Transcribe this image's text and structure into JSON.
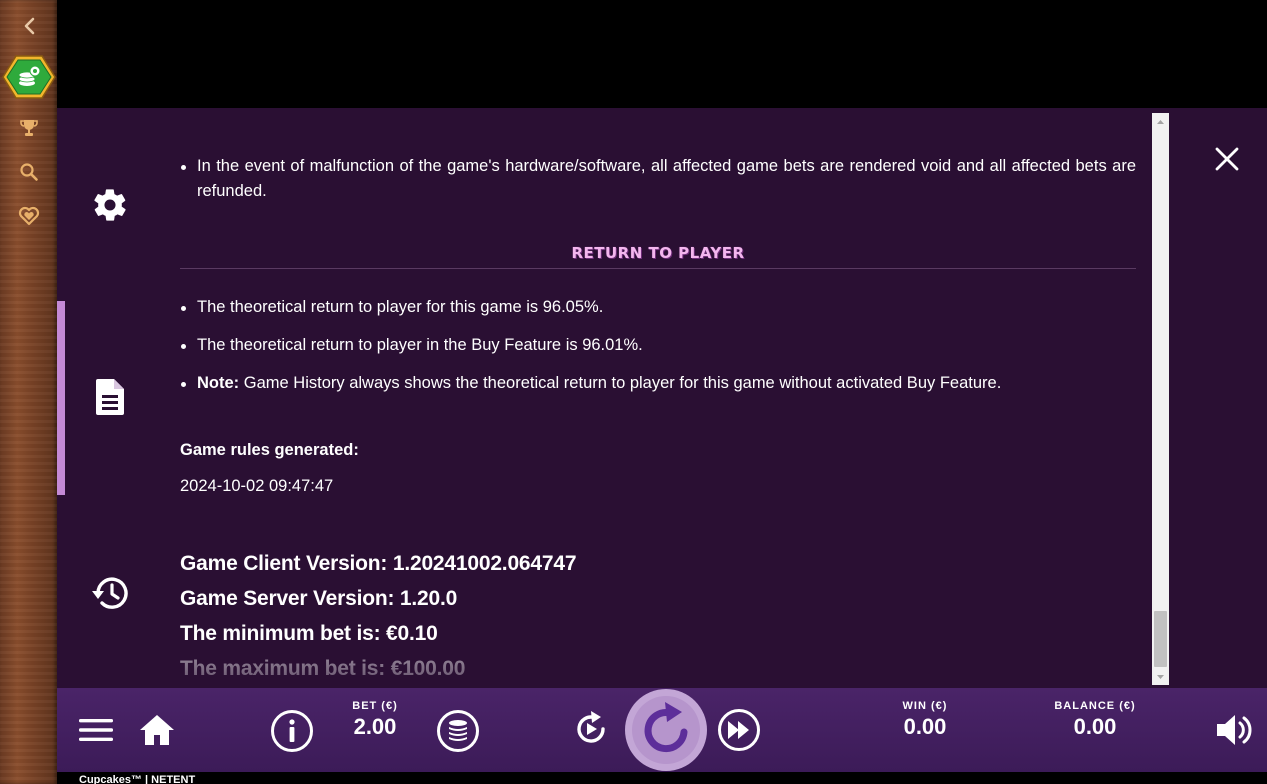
{
  "rules": {
    "malfunction_text": "In the event of malfunction of the game's hardware/software, all affected game bets are rendered void and all affected bets are refunded.",
    "rtp_heading": "RETURN TO PLAYER",
    "rtp_items": [
      "The theoretical return to player for this game is 96.05%.",
      "The theoretical return to player in the Buy Feature is 96.01%."
    ],
    "note_label": "Note:",
    "note_text": "Game History always shows the theoretical return to player for this game without activated Buy Feature.",
    "generated_label": "Game rules generated:",
    "generated_value": "2024-10-02 09:47:47",
    "client_version": "Game Client Version: 1.20241002.064747",
    "server_version": "Game Server Version: 1.20.0",
    "min_bet": "The minimum bet is: €0.10",
    "max_bet": "The maximum bet is: €100.00"
  },
  "bottom_bar": {
    "bet_label": "BET (€)",
    "bet_value": "2.00",
    "win_label": "WIN (€)",
    "win_value": "0.00",
    "balance_label": "BALANCE (€)",
    "balance_value": "0.00"
  },
  "footer": {
    "text": "Cupcakes™ | NETENT"
  },
  "icons": {
    "rail": [
      "back-arrow-icon",
      "coins-logo-icon",
      "trophy-icon",
      "search-icon",
      "heart-icon"
    ],
    "panel": [
      "settings-icon",
      "rules-document-icon",
      "history-icon",
      "close-icon"
    ],
    "bar": [
      "menu-icon",
      "home-icon",
      "info-icon",
      "coins-icon",
      "autoplay-icon",
      "spin-icon",
      "turbo-icon",
      "sound-icon"
    ]
  },
  "colors": {
    "panel_bg": "#2a0f33",
    "bar_bg": "#4a2468",
    "accent": "#c48ad6",
    "heading": "#f3b6ee",
    "rail_icon": "#e8b06a",
    "logo_green": "#2faa3c"
  }
}
